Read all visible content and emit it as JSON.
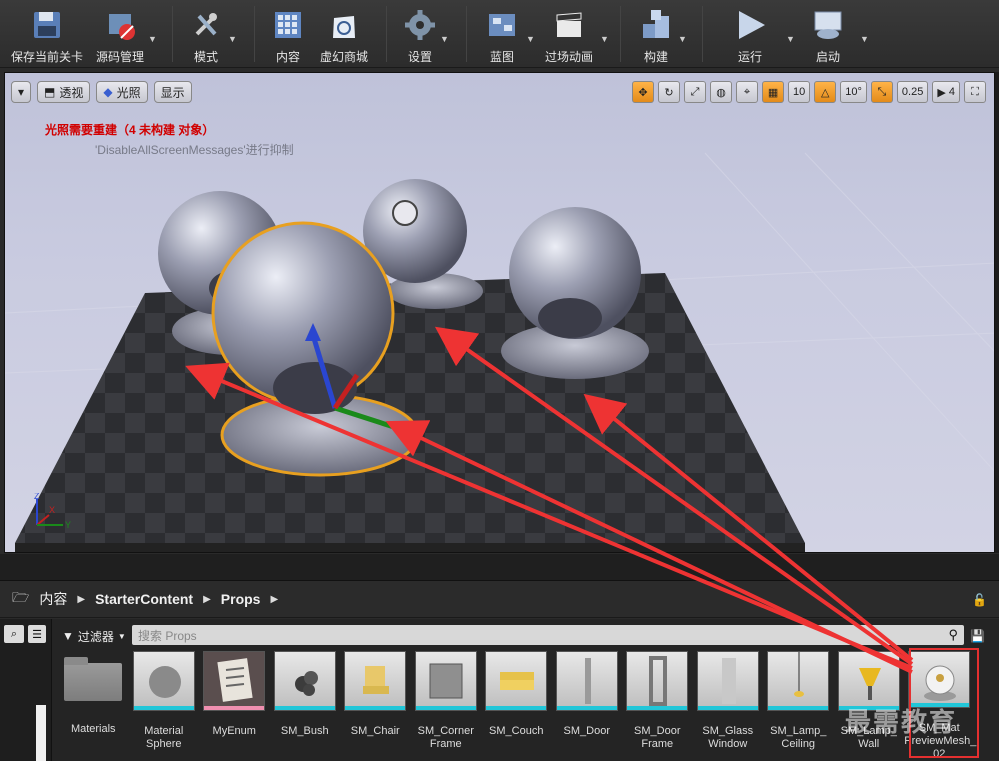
{
  "toolbar": {
    "items": [
      {
        "label": "保存当前关卡"
      },
      {
        "label": "源码管理"
      },
      {
        "label": "模式"
      },
      {
        "label": "内容"
      },
      {
        "label": "虚幻商城"
      },
      {
        "label": "设置"
      },
      {
        "label": "蓝图"
      },
      {
        "label": "过场动画"
      },
      {
        "label": "构建"
      },
      {
        "label": "运行"
      },
      {
        "label": "启动"
      }
    ]
  },
  "viewport": {
    "perspective_label": "透视",
    "lighting_label": "光照",
    "show_label": "显示",
    "grid_snap_value": "10",
    "rotation_snap_value": "10°",
    "scale_snap_value": "0.25",
    "camera_speed_value": "4",
    "message_lighting": "光照需要重建（4 未构建 对象）",
    "message_suppress": "'DisableAllScreenMessages'进行抑制",
    "axis_labels": {
      "z": "Z",
      "x": "X",
      "y": "Y"
    }
  },
  "content_browser": {
    "breadcrumb": [
      "内容",
      "StarterContent",
      "Props"
    ],
    "filter_label": "过滤器",
    "search_placeholder": "搜索 Props",
    "assets": [
      {
        "label": "Materials",
        "kind": "folder"
      },
      {
        "label": "Material Sphere",
        "kind": "asset"
      },
      {
        "label": "MyEnum",
        "kind": "enum"
      },
      {
        "label": "SM_Bush",
        "kind": "asset"
      },
      {
        "label": "SM_Chair",
        "kind": "asset"
      },
      {
        "label": "SM_Corner Frame",
        "kind": "asset"
      },
      {
        "label": "SM_Couch",
        "kind": "asset"
      },
      {
        "label": "SM_Door",
        "kind": "asset"
      },
      {
        "label": "SM_Door Frame",
        "kind": "asset"
      },
      {
        "label": "SM_Glass Window",
        "kind": "asset"
      },
      {
        "label": "SM_Lamp_ Ceiling",
        "kind": "asset"
      },
      {
        "label": "SM_Lamp_ Wall",
        "kind": "asset"
      },
      {
        "label": "SM_Mat PreviewMesh_ 02",
        "kind": "asset"
      }
    ]
  },
  "watermark": "最需教育",
  "colors": {
    "accent_orange": "#e8a020",
    "arrow_red": "#ee3333",
    "thumb_bar": "#21c6d8"
  }
}
